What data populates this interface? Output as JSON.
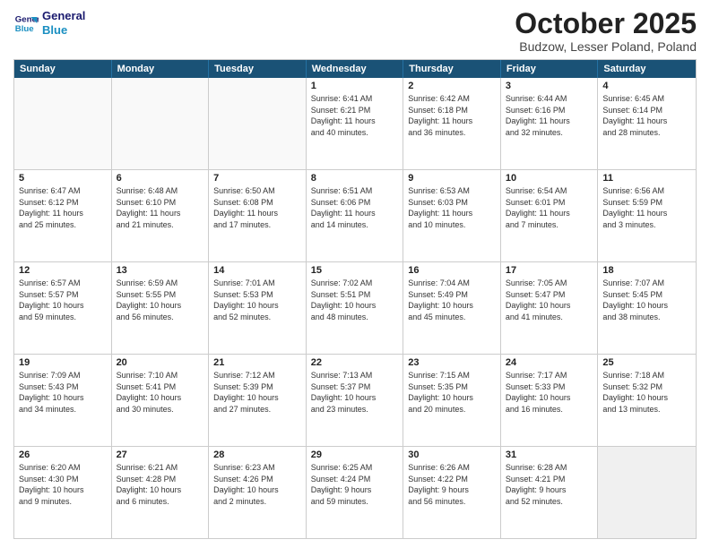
{
  "header": {
    "logo_line1": "General",
    "logo_line2": "Blue",
    "month": "October 2025",
    "location": "Budzow, Lesser Poland, Poland"
  },
  "day_headers": [
    "Sunday",
    "Monday",
    "Tuesday",
    "Wednesday",
    "Thursday",
    "Friday",
    "Saturday"
  ],
  "weeks": [
    [
      {
        "day": "",
        "info": ""
      },
      {
        "day": "",
        "info": ""
      },
      {
        "day": "",
        "info": ""
      },
      {
        "day": "1",
        "info": "Sunrise: 6:41 AM\nSunset: 6:21 PM\nDaylight: 11 hours\nand 40 minutes."
      },
      {
        "day": "2",
        "info": "Sunrise: 6:42 AM\nSunset: 6:18 PM\nDaylight: 11 hours\nand 36 minutes."
      },
      {
        "day": "3",
        "info": "Sunrise: 6:44 AM\nSunset: 6:16 PM\nDaylight: 11 hours\nand 32 minutes."
      },
      {
        "day": "4",
        "info": "Sunrise: 6:45 AM\nSunset: 6:14 PM\nDaylight: 11 hours\nand 28 minutes."
      }
    ],
    [
      {
        "day": "5",
        "info": "Sunrise: 6:47 AM\nSunset: 6:12 PM\nDaylight: 11 hours\nand 25 minutes."
      },
      {
        "day": "6",
        "info": "Sunrise: 6:48 AM\nSunset: 6:10 PM\nDaylight: 11 hours\nand 21 minutes."
      },
      {
        "day": "7",
        "info": "Sunrise: 6:50 AM\nSunset: 6:08 PM\nDaylight: 11 hours\nand 17 minutes."
      },
      {
        "day": "8",
        "info": "Sunrise: 6:51 AM\nSunset: 6:06 PM\nDaylight: 11 hours\nand 14 minutes."
      },
      {
        "day": "9",
        "info": "Sunrise: 6:53 AM\nSunset: 6:03 PM\nDaylight: 11 hours\nand 10 minutes."
      },
      {
        "day": "10",
        "info": "Sunrise: 6:54 AM\nSunset: 6:01 PM\nDaylight: 11 hours\nand 7 minutes."
      },
      {
        "day": "11",
        "info": "Sunrise: 6:56 AM\nSunset: 5:59 PM\nDaylight: 11 hours\nand 3 minutes."
      }
    ],
    [
      {
        "day": "12",
        "info": "Sunrise: 6:57 AM\nSunset: 5:57 PM\nDaylight: 10 hours\nand 59 minutes."
      },
      {
        "day": "13",
        "info": "Sunrise: 6:59 AM\nSunset: 5:55 PM\nDaylight: 10 hours\nand 56 minutes."
      },
      {
        "day": "14",
        "info": "Sunrise: 7:01 AM\nSunset: 5:53 PM\nDaylight: 10 hours\nand 52 minutes."
      },
      {
        "day": "15",
        "info": "Sunrise: 7:02 AM\nSunset: 5:51 PM\nDaylight: 10 hours\nand 48 minutes."
      },
      {
        "day": "16",
        "info": "Sunrise: 7:04 AM\nSunset: 5:49 PM\nDaylight: 10 hours\nand 45 minutes."
      },
      {
        "day": "17",
        "info": "Sunrise: 7:05 AM\nSunset: 5:47 PM\nDaylight: 10 hours\nand 41 minutes."
      },
      {
        "day": "18",
        "info": "Sunrise: 7:07 AM\nSunset: 5:45 PM\nDaylight: 10 hours\nand 38 minutes."
      }
    ],
    [
      {
        "day": "19",
        "info": "Sunrise: 7:09 AM\nSunset: 5:43 PM\nDaylight: 10 hours\nand 34 minutes."
      },
      {
        "day": "20",
        "info": "Sunrise: 7:10 AM\nSunset: 5:41 PM\nDaylight: 10 hours\nand 30 minutes."
      },
      {
        "day": "21",
        "info": "Sunrise: 7:12 AM\nSunset: 5:39 PM\nDaylight: 10 hours\nand 27 minutes."
      },
      {
        "day": "22",
        "info": "Sunrise: 7:13 AM\nSunset: 5:37 PM\nDaylight: 10 hours\nand 23 minutes."
      },
      {
        "day": "23",
        "info": "Sunrise: 7:15 AM\nSunset: 5:35 PM\nDaylight: 10 hours\nand 20 minutes."
      },
      {
        "day": "24",
        "info": "Sunrise: 7:17 AM\nSunset: 5:33 PM\nDaylight: 10 hours\nand 16 minutes."
      },
      {
        "day": "25",
        "info": "Sunrise: 7:18 AM\nSunset: 5:32 PM\nDaylight: 10 hours\nand 13 minutes."
      }
    ],
    [
      {
        "day": "26",
        "info": "Sunrise: 6:20 AM\nSunset: 4:30 PM\nDaylight: 10 hours\nand 9 minutes."
      },
      {
        "day": "27",
        "info": "Sunrise: 6:21 AM\nSunset: 4:28 PM\nDaylight: 10 hours\nand 6 minutes."
      },
      {
        "day": "28",
        "info": "Sunrise: 6:23 AM\nSunset: 4:26 PM\nDaylight: 10 hours\nand 2 minutes."
      },
      {
        "day": "29",
        "info": "Sunrise: 6:25 AM\nSunset: 4:24 PM\nDaylight: 9 hours\nand 59 minutes."
      },
      {
        "day": "30",
        "info": "Sunrise: 6:26 AM\nSunset: 4:22 PM\nDaylight: 9 hours\nand 56 minutes."
      },
      {
        "day": "31",
        "info": "Sunrise: 6:28 AM\nSunset: 4:21 PM\nDaylight: 9 hours\nand 52 minutes."
      },
      {
        "day": "",
        "info": ""
      }
    ]
  ]
}
